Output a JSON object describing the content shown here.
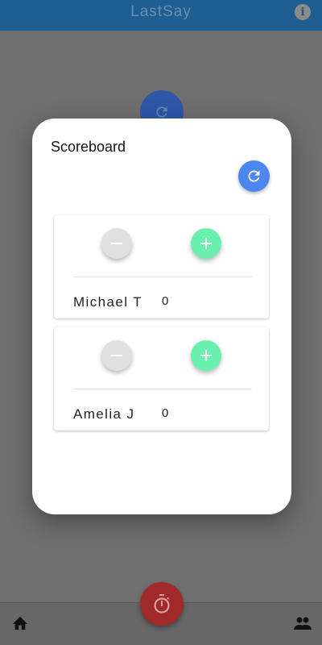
{
  "app": {
    "title": "LastSay"
  },
  "dialog": {
    "title": "Scoreboard"
  },
  "players": [
    {
      "name": "Michael T",
      "score": "0"
    },
    {
      "name": "Amelia J",
      "score": "0"
    }
  ],
  "icons": {
    "info": "info-icon",
    "refresh": "refresh-icon",
    "minus": "minus-icon",
    "plus": "plus-icon",
    "home": "home-icon",
    "people": "people-icon",
    "timer": "timer-icon"
  },
  "colors": {
    "app_bar": "#1f5e92",
    "refresh_button": "#4e86ef",
    "plus_button": "#69f0ae",
    "minus_button": "#e0e0e0",
    "timer_fab": "#a02a2a"
  }
}
